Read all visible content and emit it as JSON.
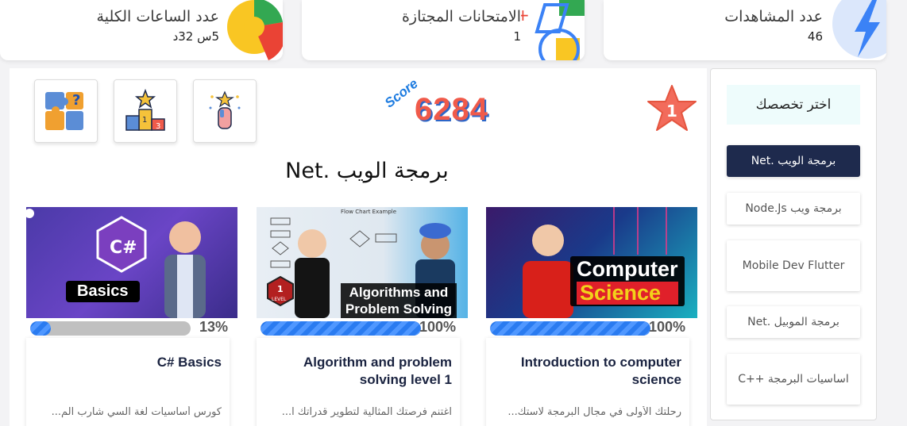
{
  "stats": [
    {
      "title": "عدد الساعات الكلية",
      "value": "5س 32د",
      "icon": "chrome-style-clock-icon"
    },
    {
      "title": "الامتحانات المجتازة",
      "value": "1",
      "icon": "bicycle-icon"
    },
    {
      "title": "عدد المشاهدات",
      "value": "46",
      "icon": "lightning-icon"
    }
  ],
  "toolbar": {
    "puzzle_icon": "puzzle-icon",
    "podium_icon": "podium-icon",
    "hand_icon": "hand-star-icon"
  },
  "score": {
    "label": "Score",
    "value": "6284",
    "rank": "1"
  },
  "section_title": "برمجة الويب .Net",
  "courses": [
    {
      "image_caption": "Basics",
      "progress": 13,
      "progress_label": "13%",
      "title": "C# Basics",
      "desc": "كورس أساسيات لغة السي شارب الم..."
    },
    {
      "image_caption_line1": "Algorithms and",
      "image_caption_line2": "Problem Solving",
      "image_header": "Flow Chart Example",
      "badge": "1",
      "badge_sub": "LEVEL",
      "progress": 100,
      "progress_label": "100%",
      "title": "Algorithm and problem solving level 1",
      "desc": "اغتنم فرصتك المثالية لتطوير قدراتك ا..."
    },
    {
      "image_caption_line1": "Computer",
      "image_caption_line2": "Science",
      "progress": 100,
      "progress_label": "100%",
      "title": "Introduction to computer science",
      "desc": "رحلتك الأولى في مجال البرمجة لاستك..."
    }
  ],
  "sidebar": {
    "title": "اختر تخصصك",
    "items": [
      {
        "label": "برمجة الويب .Net",
        "active": true
      },
      {
        "label": "برمجة ويب Node.Js",
        "active": false
      },
      {
        "label": "Mobile Dev Flutter",
        "active": false
      },
      {
        "label": "برمجة الموبيل .Net",
        "active": false
      },
      {
        "label": "اساسيات البرمجة ++C",
        "active": false
      }
    ]
  },
  "colors": {
    "accent_dark": "#1e2a4d",
    "progress_blue": "#2a7bf0",
    "score_red": "#f05a4a"
  }
}
